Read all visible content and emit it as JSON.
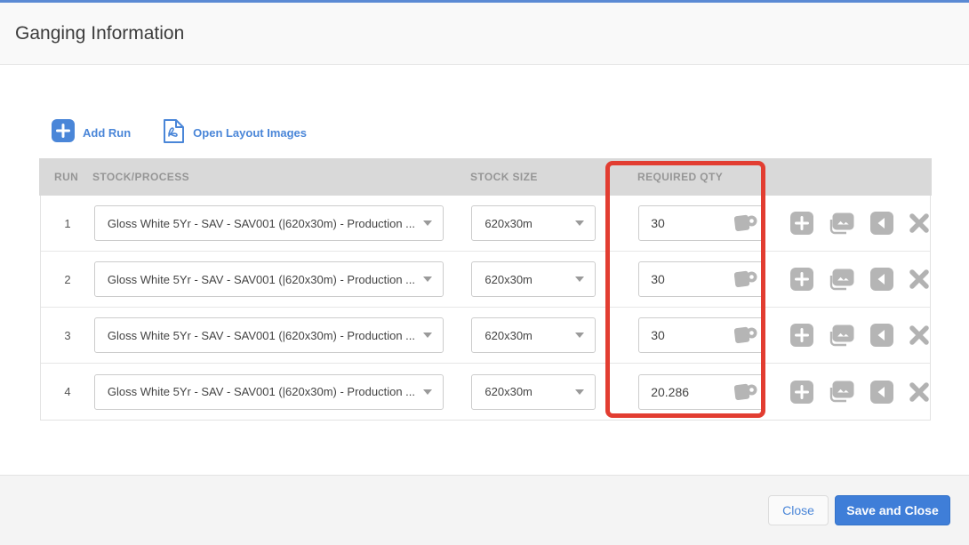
{
  "dialog": {
    "title": "Ganging Information",
    "accent_color": "#5b8ad4",
    "highlight_color": "#e23d31"
  },
  "toolbar": {
    "add_run_label": "Add Run",
    "open_layout_label": "Open Layout Images",
    "icons": {
      "add_run": "plus-square",
      "open_layout": "pdf-file"
    }
  },
  "table": {
    "headers": [
      "RUN",
      "STOCK/PROCESS",
      "STOCK SIZE",
      "REQUIRED QTY"
    ],
    "row_action_icons": [
      "add-run-below",
      "layout-images",
      "move-left",
      "remove-run"
    ],
    "qty_unit_icon": "material-roll",
    "rows": [
      {
        "run": "1",
        "stock_process": "Gloss White 5Yr - SAV - SAV001 (|620x30m) - Production ...",
        "stock_size": "620x30m",
        "required_qty": "30"
      },
      {
        "run": "2",
        "stock_process": "Gloss White 5Yr - SAV - SAV001 (|620x30m) - Production ...",
        "stock_size": "620x30m",
        "required_qty": "30"
      },
      {
        "run": "3",
        "stock_process": "Gloss White 5Yr - SAV - SAV001 (|620x30m) - Production ...",
        "stock_size": "620x30m",
        "required_qty": "30"
      },
      {
        "run": "4",
        "stock_process": "Gloss White 5Yr - SAV - SAV001 (|620x30m) - Production ...",
        "stock_size": "620x30m",
        "required_qty": "20.286"
      }
    ]
  },
  "footer": {
    "close_label": "Close",
    "save_label": "Save and Close"
  }
}
